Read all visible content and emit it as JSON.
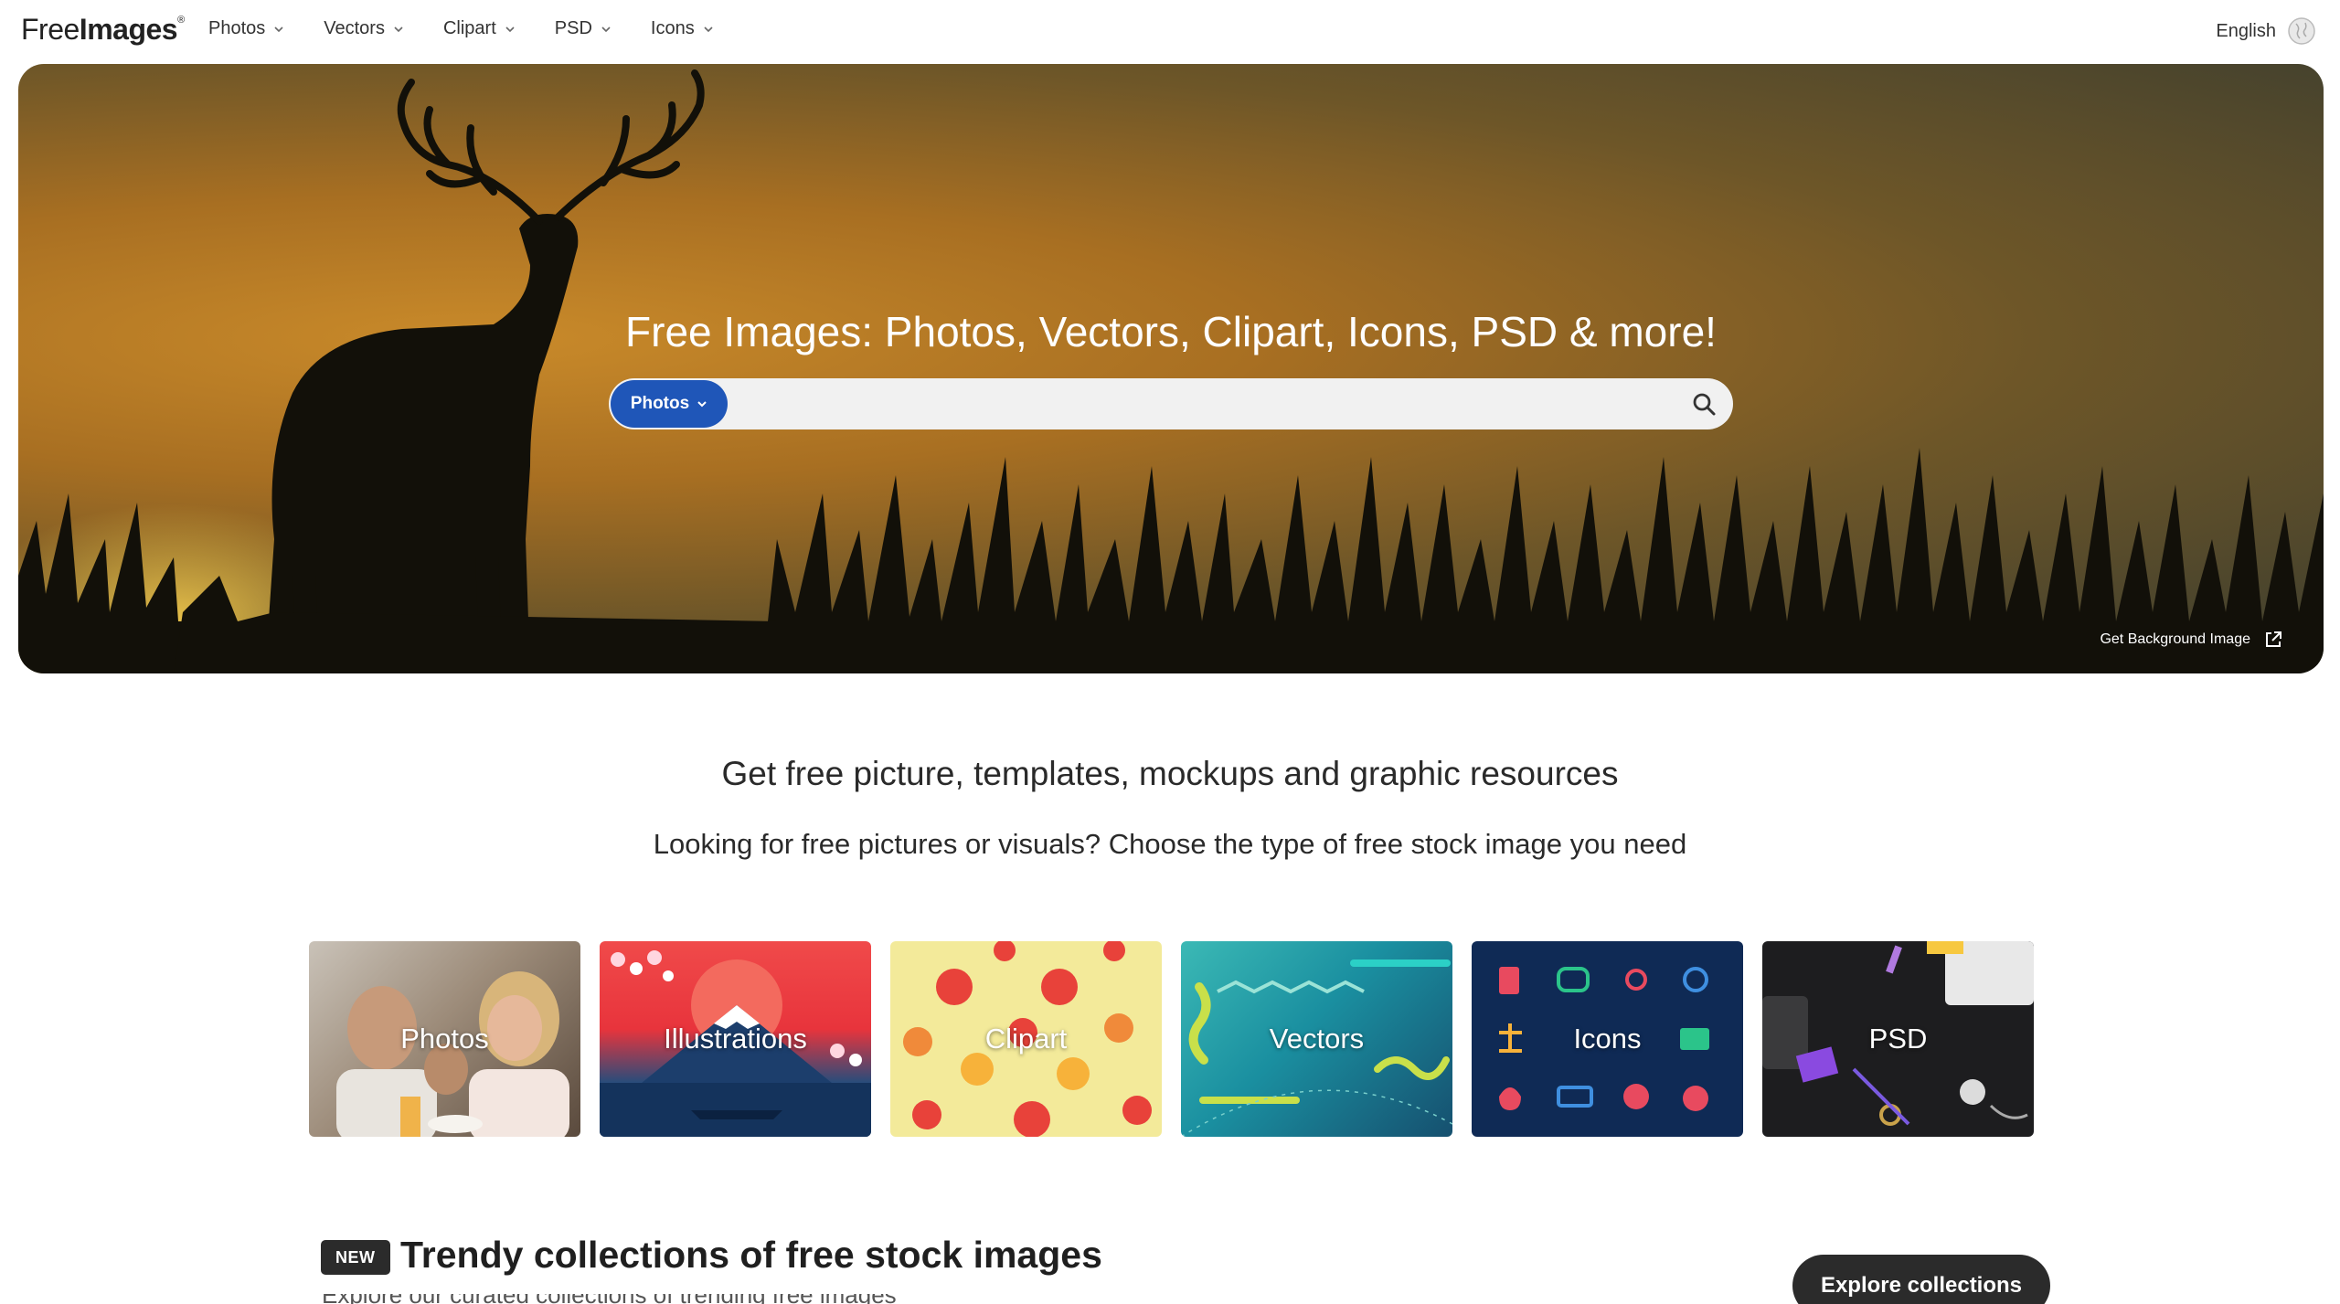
{
  "header": {
    "logo": {
      "part1": "Free",
      "part2": "Images",
      "mark": "®"
    },
    "nav": [
      {
        "label": "Photos",
        "icon": "chevron-down-icon"
      },
      {
        "label": "Vectors",
        "icon": "chevron-down-icon"
      },
      {
        "label": "Clipart",
        "icon": "chevron-down-icon"
      },
      {
        "label": "PSD",
        "icon": "chevron-down-icon"
      },
      {
        "label": "Icons",
        "icon": "chevron-down-icon"
      }
    ],
    "language": {
      "label": "English",
      "icon": "globe-icon"
    }
  },
  "hero": {
    "title": "Free Images: Photos, Vectors, Clipart, Icons, PSD & more!",
    "search": {
      "type_label": "Photos",
      "placeholder": "",
      "value": "",
      "icon": "search-icon"
    },
    "get_background": {
      "label": "Get Background Image",
      "icon": "external-link-icon"
    }
  },
  "intro": {
    "title": "Get free picture, templates, mockups and graphic resources",
    "subtitle": "Looking for free pictures or visuals? Choose the type of free stock image you need"
  },
  "categories": [
    {
      "label": "Photos"
    },
    {
      "label": "Illustrations"
    },
    {
      "label": "Clipart"
    },
    {
      "label": "Vectors"
    },
    {
      "label": "Icons"
    },
    {
      "label": "PSD"
    }
  ],
  "trendy": {
    "badge": "NEW",
    "title": "Trendy collections of free stock images",
    "subtitle": "Explore our curated collections of trending free images",
    "button": "Explore collections"
  },
  "colors": {
    "accent_blue": "#1f56b8",
    "dark_button": "#2b2b2b",
    "text": "#1f1f1f"
  }
}
